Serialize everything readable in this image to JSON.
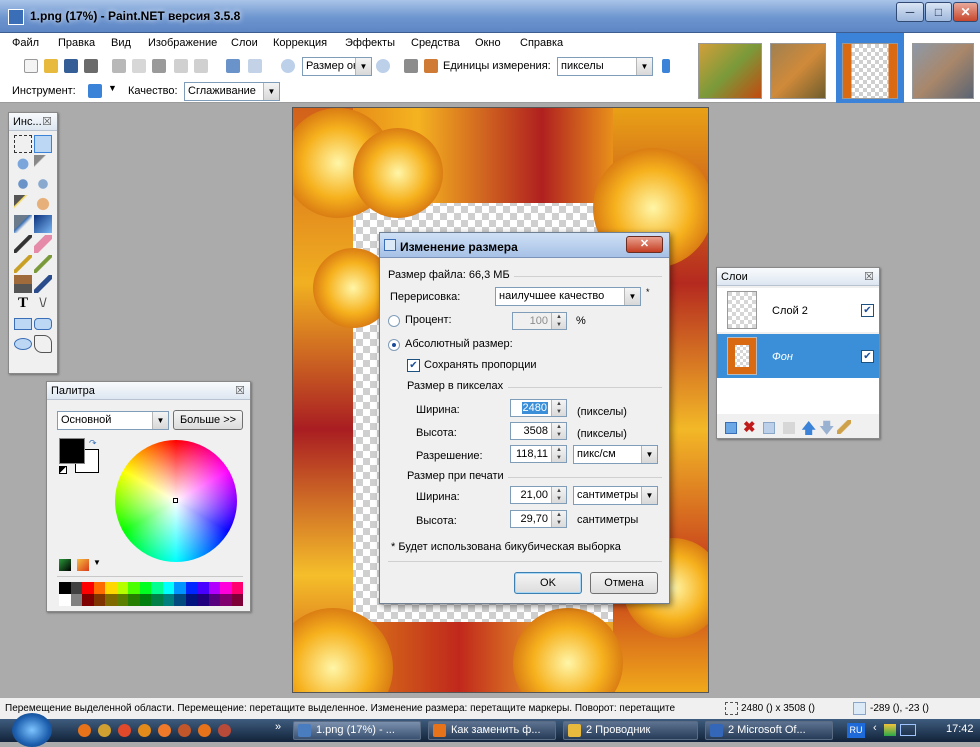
{
  "window": {
    "title": "1.png (17%) - Paint.NET версия 3.5.8",
    "min_label": "─",
    "max_label": "□",
    "close_label": "✕"
  },
  "menu": [
    "Файл",
    "Правка",
    "Вид",
    "Изображение",
    "Слои",
    "Коррекция",
    "Эффекты",
    "Средства",
    "Окно",
    "Справка"
  ],
  "toolbar": {
    "zoom_value": "Размер окі",
    "units_label": "Единицы измерения:",
    "units_value": "пикселы"
  },
  "toolbar2": {
    "tool_label": "Инструмент:",
    "quality_label": "Качество:",
    "quality_value": "Сглаживание"
  },
  "tools_panel": {
    "title": "Инс...",
    "close": "☒"
  },
  "palette": {
    "title": "Палитра",
    "close": "☒",
    "mode_value": "Основной",
    "more_label": "Больше >>",
    "colors": [
      "#000000",
      "#404040",
      "#ff0000",
      "#ff6a00",
      "#ffd800",
      "#b6ff00",
      "#4cff00",
      "#00ff21",
      "#00ff90",
      "#00ffff",
      "#0094ff",
      "#0026ff",
      "#4800ff",
      "#b200ff",
      "#ff00dc",
      "#ff006e",
      "#ffffff",
      "#808080",
      "#7f0000",
      "#7f3300",
      "#7f6a00",
      "#5b7f00",
      "#267f00",
      "#007f0e",
      "#007f46",
      "#007f7f",
      "#004a7f",
      "#00137f",
      "#21007f",
      "#57007f",
      "#7f006e",
      "#7f0037"
    ]
  },
  "layers": {
    "title": "Слои",
    "close": "☒",
    "items": [
      {
        "name": "Слой 2",
        "checked": true,
        "selected": false
      },
      {
        "name": "Фон",
        "checked": true,
        "selected": true
      }
    ]
  },
  "dialog": {
    "title": "Изменение размера",
    "close": "✕",
    "file_size": "Размер файла: 66,3 МБ",
    "resample_label": "Перерисовка:",
    "resample_value": "наилучшее качество",
    "asterisk": "*",
    "percent_label": "Процент:",
    "percent_value": "100",
    "percent_unit": "%",
    "absolute_label": "Абсолютный размер:",
    "keep_ratio_label": "Сохранять пропорции",
    "pixel_size_label": "Размер в пикселах",
    "width_label": "Ширина:",
    "width_px": "2480",
    "height_label": "Высота:",
    "height_px": "3508",
    "px_unit": "(пикселы)",
    "resolution_label": "Разрешение:",
    "resolution_value": "118,11",
    "resolution_unit": "пикс/см",
    "print_size_label": "Размер при печати",
    "print_width": "21,00",
    "print_height": "29,70",
    "cm_unit_combo": "сантиметры",
    "cm_unit": "сантиметры",
    "note": "* Будет использована бикубическая выборка",
    "ok_label": "OK",
    "cancel_label": "Отмена"
  },
  "status": {
    "hint": "Перемещение выделенной области. Перемещение: перетащите выделенное. Изменение размера: перетащите маркеры. Поворот: перетащите",
    "size": "2480 () x 3508 ()",
    "coords": "-289 (), -23 ()"
  },
  "taskbar": {
    "tasks": [
      {
        "label": "1.png (17%) - ...",
        "color": "#4a7cc0"
      },
      {
        "label": "Как заменить ф...",
        "color": "#e6721a"
      },
      {
        "label": "2 Проводник",
        "color": "#e7b93d"
      },
      {
        "label": "2 Microsoft Of...",
        "color": "#3467b8"
      }
    ],
    "lang": "RU",
    "time": "17:42"
  }
}
